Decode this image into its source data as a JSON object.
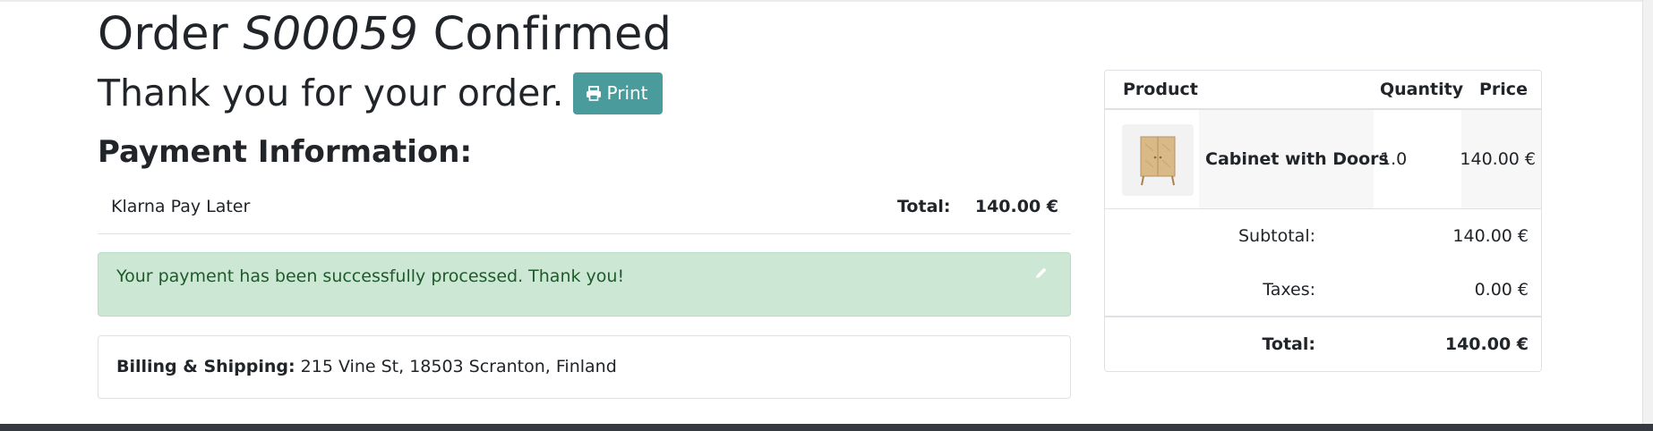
{
  "order": {
    "title_prefix": "Order",
    "number": "S00059",
    "title_suffix": "Confirmed",
    "thank_you": "Thank you for your order.",
    "print_label": "Print"
  },
  "payment": {
    "heading": "Payment Information:",
    "method": "Klarna Pay Later",
    "total_label": "Total:",
    "total_value": "140.00 €",
    "success_message": "Your payment has been successfully processed. Thank you!"
  },
  "billing": {
    "label": "Billing & Shipping:",
    "address": "215 Vine St, 18503 Scranton, Finland"
  },
  "summary": {
    "columns": [
      "Product",
      "Quantity",
      "Price"
    ],
    "items": [
      {
        "name": "Cabinet with Doors",
        "quantity": "1.0",
        "price": "140.00 €",
        "image": "cabinet-image"
      }
    ],
    "subtotal_label": "Subtotal:",
    "subtotal_value": "140.00 €",
    "taxes_label": "Taxes:",
    "taxes_value": "0.00 €",
    "total_label": "Total:",
    "total_value": "140.00 €"
  },
  "colors": {
    "print_button": "#4a9b9c",
    "success_bg": "#cde7d5",
    "success_text": "#1e5a2a",
    "footer": "#343a40"
  },
  "icons": {
    "print": "printer-icon",
    "edit": "pencil-icon"
  }
}
